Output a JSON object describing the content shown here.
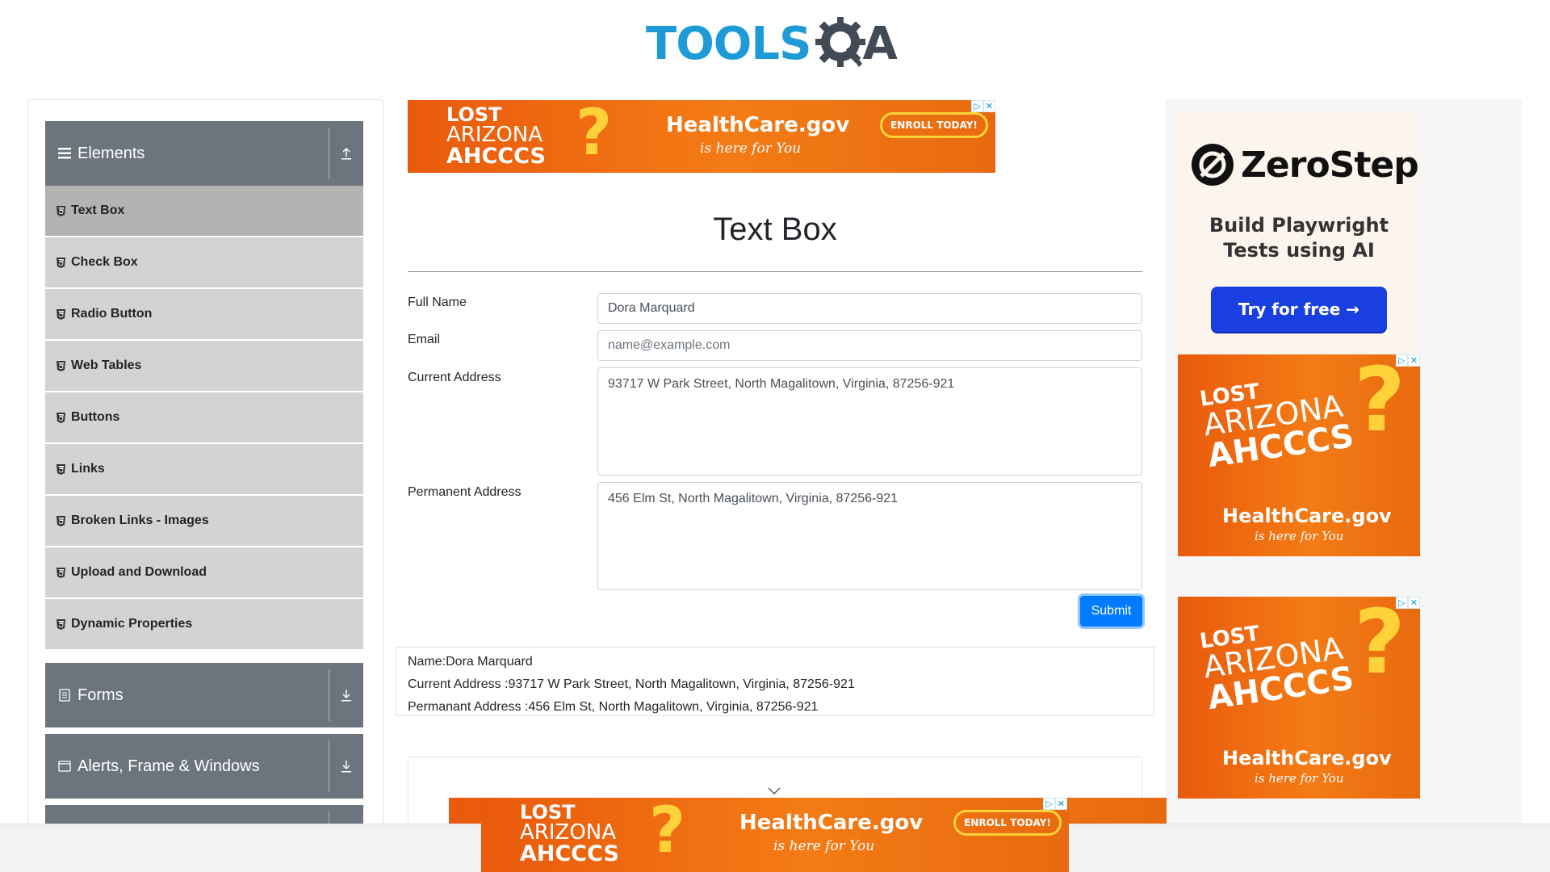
{
  "header": {
    "logo_tools": "TOOLS",
    "logo_qa": "A"
  },
  "sidebar": {
    "groups": [
      {
        "label": "Elements",
        "toggle": "collapse"
      },
      {
        "label": "Forms",
        "toggle": "expand"
      },
      {
        "label": "Alerts, Frame & Windows",
        "toggle": "expand"
      }
    ],
    "items": [
      {
        "label": "Text Box"
      },
      {
        "label": "Check Box"
      },
      {
        "label": "Radio Button"
      },
      {
        "label": "Web Tables"
      },
      {
        "label": "Buttons"
      },
      {
        "label": "Links"
      },
      {
        "label": "Broken Links - Images"
      },
      {
        "label": "Upload and Download"
      },
      {
        "label": "Dynamic Properties"
      }
    ]
  },
  "main": {
    "title": "Text Box",
    "full_name_label": "Full Name",
    "full_name_value": "Dora Marquard",
    "email_label": "Email",
    "email_placeholder": "name@example.com",
    "current_address_label": "Current Address",
    "current_address_value": "93717 W Park Street, North Magalitown, Virginia, 87256-921",
    "permanent_address_label": "Permanent Address",
    "permanent_address_value": "456 Elm St, North Magalitown, Virginia, 87256-921",
    "submit_label": "Submit",
    "output": {
      "name": "Name:Dora Marquard",
      "current_address": "Current Address :93717 W Park Street, North Magalitown, Virginia, 87256-921",
      "permanent_address": "Permanant Address :456 Elm St, North Magalitown, Virginia, 87256-921"
    }
  },
  "ads": {
    "lost_line1": "LOST",
    "lost_line2": "ARIZONA",
    "lost_line3": "AHCCCS",
    "healthcare": "HealthCare.gov",
    "tagline": "is here for You",
    "enroll": "ENROLL TODAY!",
    "zerostep_name": "ZeroStep",
    "zerostep_tagline_1": "Build Playwright",
    "zerostep_tagline_2": "Tests using AI",
    "zerostep_button": "Try for free →"
  },
  "colors": {
    "brand_blue": "#1e9bd7",
    "sidebar_header": "#6c757d",
    "menu_item": "#d3d3d3",
    "menu_item_active": "#b3b3b3",
    "submit": "#007bff",
    "ad_orange": "#f47b15",
    "zerostep_button": "#1a3fe0"
  }
}
